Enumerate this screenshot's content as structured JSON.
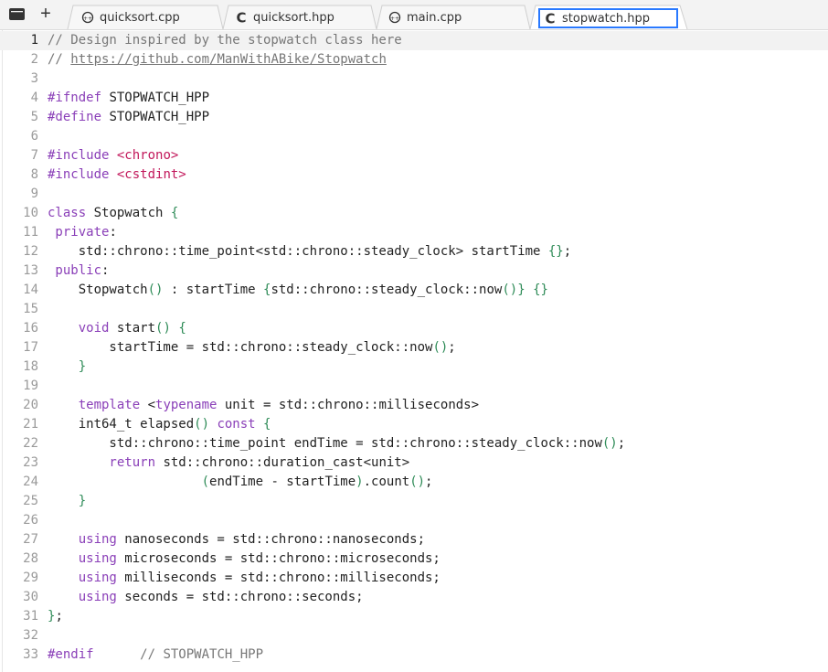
{
  "tabs": [
    {
      "label": "quicksort.cpp",
      "icon": "cpp-file-icon",
      "active": false
    },
    {
      "label": "quicksort.hpp",
      "icon": "c-header-file-icon",
      "active": false
    },
    {
      "label": "main.cpp",
      "icon": "cpp-file-icon",
      "active": false
    },
    {
      "label": "stopwatch.hpp",
      "icon": "c-header-file-icon",
      "active": true
    }
  ],
  "toolbar": {
    "menu_icon": "menu-icon",
    "add_tab": "+"
  },
  "editor": {
    "current_line": 1,
    "lines": [
      {
        "n": "1",
        "t": [
          [
            "c",
            "// Design inspired by the stopwatch class here"
          ]
        ]
      },
      {
        "n": "2",
        "t": [
          [
            "c",
            "// "
          ],
          [
            "u",
            "https://github.com/ManWithABike/Stopwatch"
          ]
        ]
      },
      {
        "n": "3",
        "t": []
      },
      {
        "n": "4",
        "t": [
          [
            "pp",
            "#ifndef"
          ],
          [
            "p",
            " STOPWATCH_HPP"
          ]
        ]
      },
      {
        "n": "5",
        "t": [
          [
            "pp",
            "#define"
          ],
          [
            "p",
            " STOPWATCH_HPP"
          ]
        ]
      },
      {
        "n": "6",
        "t": []
      },
      {
        "n": "7",
        "t": [
          [
            "pp",
            "#include"
          ],
          [
            "p",
            " "
          ],
          [
            "s",
            "<chrono>"
          ]
        ]
      },
      {
        "n": "8",
        "t": [
          [
            "pp",
            "#include"
          ],
          [
            "p",
            " "
          ],
          [
            "s",
            "<cstdint>"
          ]
        ]
      },
      {
        "n": "9",
        "t": []
      },
      {
        "n": "10",
        "t": [
          [
            "k",
            "class"
          ],
          [
            "p",
            " Stopwatch "
          ],
          [
            "b",
            "{"
          ]
        ]
      },
      {
        "n": "11",
        "t": [
          [
            "k",
            " private"
          ],
          [
            "p",
            ":"
          ]
        ]
      },
      {
        "n": "12",
        "t": [
          [
            "p",
            "    std::chrono::time_point<std::chrono::steady_clock> startTime "
          ],
          [
            "b",
            "{}"
          ],
          [
            "p",
            ";"
          ]
        ]
      },
      {
        "n": "13",
        "t": [
          [
            "k",
            " public"
          ],
          [
            "p",
            ":"
          ]
        ]
      },
      {
        "n": "14",
        "t": [
          [
            "p",
            "    Stopwatch"
          ],
          [
            "b",
            "()"
          ],
          [
            "p",
            " : startTime "
          ],
          [
            "b",
            "{"
          ],
          [
            "p",
            "std::chrono::steady_clock::now"
          ],
          [
            "b",
            "()"
          ],
          [
            "b",
            "}"
          ],
          [
            "p",
            " "
          ],
          [
            "b",
            "{}"
          ]
        ]
      },
      {
        "n": "15",
        "t": []
      },
      {
        "n": "16",
        "t": [
          [
            "k",
            "    void"
          ],
          [
            "p",
            " start"
          ],
          [
            "b",
            "()"
          ],
          [
            "p",
            " "
          ],
          [
            "b",
            "{"
          ]
        ]
      },
      {
        "n": "17",
        "t": [
          [
            "p",
            "        startTime = std::chrono::steady_clock::now"
          ],
          [
            "b",
            "()"
          ],
          [
            "p",
            ";"
          ]
        ]
      },
      {
        "n": "18",
        "t": [
          [
            "b",
            "    }"
          ]
        ]
      },
      {
        "n": "19",
        "t": []
      },
      {
        "n": "20",
        "t": [
          [
            "k",
            "    template"
          ],
          [
            "p",
            " <"
          ],
          [
            "k",
            "typename"
          ],
          [
            "p",
            " unit = std::chrono::milliseconds>"
          ]
        ]
      },
      {
        "n": "21",
        "t": [
          [
            "p",
            "    int64_t elapsed"
          ],
          [
            "b",
            "()"
          ],
          [
            "p",
            " "
          ],
          [
            "k",
            "const"
          ],
          [
            "p",
            " "
          ],
          [
            "b",
            "{"
          ]
        ]
      },
      {
        "n": "22",
        "t": [
          [
            "p",
            "        std::chrono::time_point endTime = std::chrono::steady_clock::now"
          ],
          [
            "b",
            "()"
          ],
          [
            "p",
            ";"
          ]
        ]
      },
      {
        "n": "23",
        "t": [
          [
            "k",
            "        return"
          ],
          [
            "p",
            " std::chrono::duration_cast<unit>"
          ]
        ]
      },
      {
        "n": "24",
        "t": [
          [
            "p",
            "                    "
          ],
          [
            "b",
            "("
          ],
          [
            "p",
            "endTime - startTime"
          ],
          [
            "b",
            ")"
          ],
          [
            "p",
            ".count"
          ],
          [
            "b",
            "()"
          ],
          [
            "p",
            ";"
          ]
        ]
      },
      {
        "n": "25",
        "t": [
          [
            "b",
            "    }"
          ]
        ]
      },
      {
        "n": "26",
        "t": []
      },
      {
        "n": "27",
        "t": [
          [
            "k",
            "    using"
          ],
          [
            "p",
            " nanoseconds = std::chrono::nanoseconds;"
          ]
        ]
      },
      {
        "n": "28",
        "t": [
          [
            "k",
            "    using"
          ],
          [
            "p",
            " microseconds = std::chrono::microseconds;"
          ]
        ]
      },
      {
        "n": "29",
        "t": [
          [
            "k",
            "    using"
          ],
          [
            "p",
            " milliseconds = std::chrono::milliseconds;"
          ]
        ]
      },
      {
        "n": "30",
        "t": [
          [
            "k",
            "    using"
          ],
          [
            "p",
            " seconds = std::chrono::seconds;"
          ]
        ]
      },
      {
        "n": "31",
        "t": [
          [
            "b",
            "}"
          ],
          [
            "p",
            ";"
          ]
        ]
      },
      {
        "n": "32",
        "t": []
      },
      {
        "n": "33",
        "t": [
          [
            "pp",
            "#endif"
          ],
          [
            "p",
            "      "
          ],
          [
            "c",
            "// STOPWATCH_HPP"
          ]
        ]
      }
    ]
  },
  "colors": {
    "comment": "#777777",
    "keyword": "#8a3fb8",
    "string": "#c2185b",
    "bracket": "#2e8b57",
    "active_tab_border": "#2979ff"
  }
}
